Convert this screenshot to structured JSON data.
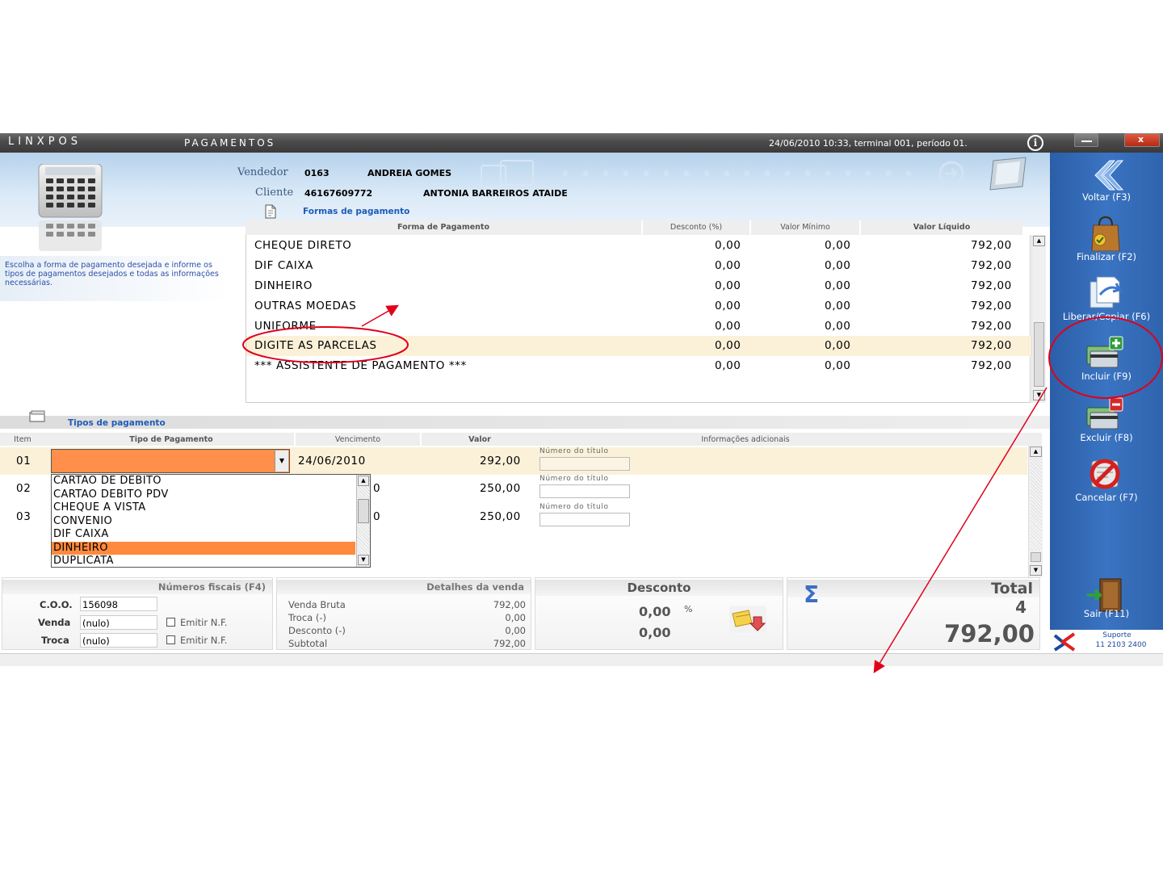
{
  "window": {
    "app_name": "LINXPOS",
    "screen_title": "PAGAMENTOS",
    "status": "24/06/2010 10:33, terminal 001, período 01.",
    "info_icon": "i"
  },
  "header": {
    "vendedor_label": "Vendedor",
    "vendedor_code": "0163",
    "vendedor_name": "ANDREIA GOMES",
    "cliente_label": "Cliente",
    "cliente_code": "46167609772",
    "cliente_name": "ANTONIA BARREIROS ATAIDE"
  },
  "hint": {
    "text": "Escolha a forma de pagamento desejada e informe os tipos de pagamentos desejados e todas as informações necessárias."
  },
  "formas": {
    "section_title": "Formas de pagamento",
    "columns": [
      "Forma de Pagamento",
      "Desconto (%)",
      "Valor Mínimo",
      "Valor Líquido"
    ],
    "rows": [
      {
        "name": "CHEQUE DIRETO",
        "desconto": "0,00",
        "minimo": "0,00",
        "liquido": "792,00"
      },
      {
        "name": "DIF CAIXA",
        "desconto": "0,00",
        "minimo": "0,00",
        "liquido": "792,00"
      },
      {
        "name": "DINHEIRO",
        "desconto": "0,00",
        "minimo": "0,00",
        "liquido": "792,00"
      },
      {
        "name": "OUTRAS MOEDAS",
        "desconto": "0,00",
        "minimo": "0,00",
        "liquido": "792,00"
      },
      {
        "name": "UNIFORME",
        "desconto": "0,00",
        "minimo": "0,00",
        "liquido": "792,00"
      },
      {
        "name": "DIGITE AS PARCELAS",
        "desconto": "0,00",
        "minimo": "0,00",
        "liquido": "792,00"
      },
      {
        "name": "*** ASSISTENTE DE PAGAMENTO ***",
        "desconto": "0,00",
        "minimo": "0,00",
        "liquido": "792,00"
      }
    ]
  },
  "tipos": {
    "section_title": "Tipos de pagamento",
    "columns": [
      "Item",
      "Tipo de Pagamento",
      "Vencimento",
      "Valor",
      "Informações adicionais"
    ],
    "rows": [
      {
        "item": "01",
        "tipo": "",
        "vencimento": "24/06/2010",
        "valor": "292,00",
        "info_label": "Número do título"
      },
      {
        "item": "02",
        "tipo": "",
        "vencimento": "0",
        "valor": "250,00",
        "info_label": "Número do título"
      },
      {
        "item": "03",
        "tipo": "",
        "vencimento": "0",
        "valor": "250,00",
        "info_label": "Número do título"
      }
    ],
    "dropdown_options": [
      "CARTAO DE DEBITO",
      "CARTAO DEBITO PDV",
      "CHEQUE A VISTA",
      "CONVENIO",
      "DIF CAIXA",
      "DINHEIRO",
      "DUPLICATA"
    ],
    "dropdown_highlighted": "DINHEIRO"
  },
  "fiscal": {
    "title": "Números fiscais (F4)",
    "coo_label": "C.O.O.",
    "coo_value": "156098",
    "venda_label": "Venda",
    "venda_value": "(nulo)",
    "troca_label": "Troca",
    "troca_value": "(nulo)",
    "emitir_label": "Emitir N.F."
  },
  "detalhes": {
    "title": "Detalhes da venda",
    "rows": [
      {
        "label": "Venda Bruta",
        "value": "792,00"
      },
      {
        "label": "Troca (-)",
        "value": "0,00"
      },
      {
        "label": "Desconto (-)",
        "value": "0,00"
      },
      {
        "label": "Subtotal",
        "value": "792,00"
      }
    ]
  },
  "desconto": {
    "title": "Desconto",
    "percent": "0,00",
    "percent_sign": "%",
    "value": "0,00"
  },
  "total": {
    "title": "Total",
    "count": "4",
    "value": "792,00",
    "sigma": "Σ"
  },
  "sidebar": {
    "items": [
      {
        "label": "Voltar (F3)",
        "icon": "back-chevron-icon"
      },
      {
        "label": "Finalizar (F2)",
        "icon": "shopping-bag-icon"
      },
      {
        "label": "Liberar/Copiar (F6)",
        "icon": "copy-icon"
      },
      {
        "label": "Incluir (F9)",
        "icon": "add-payment-icon"
      },
      {
        "label": "Excluir (F8)",
        "icon": "remove-payment-icon"
      },
      {
        "label": "Cancelar (F7)",
        "icon": "cancel-icon"
      },
      {
        "label": "Sair (F11)",
        "icon": "exit-door-icon"
      }
    ],
    "support_label": "Suporte",
    "support_phone": "11 2103 2400"
  },
  "colors": {
    "accent_orange": "#ff8a3d",
    "selected_row": "#fbf1d9",
    "sidebar_blue": "#3a74c2",
    "annotation_red": "#e0001a"
  }
}
